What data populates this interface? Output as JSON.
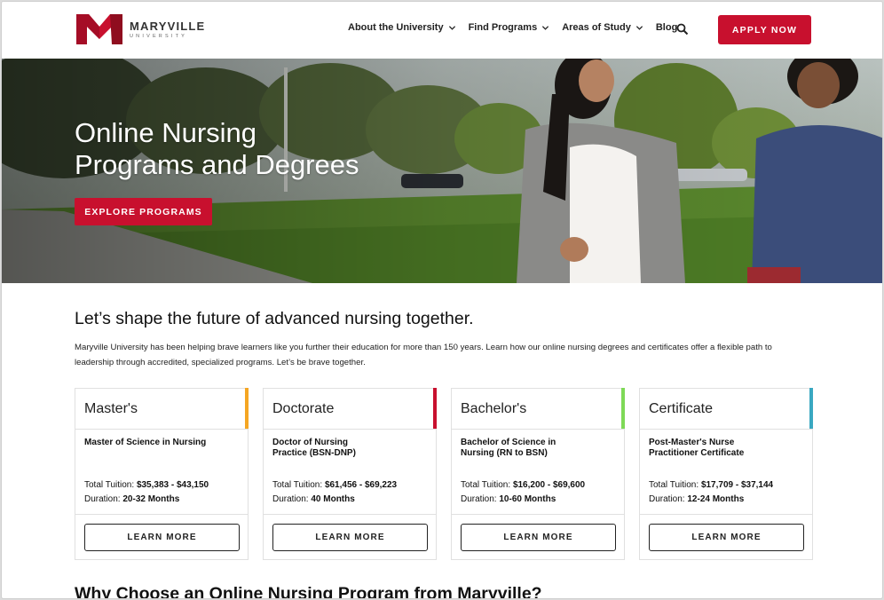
{
  "brand": {
    "name": "MARYVILLE",
    "sub": "UNIVERSITY",
    "colors": {
      "primary": "#c8102e",
      "dark_red": "#8f0d1f"
    }
  },
  "nav": {
    "items": [
      {
        "label": "About the University",
        "has_dropdown": true
      },
      {
        "label": "Find Programs",
        "has_dropdown": true
      },
      {
        "label": "Areas of Study",
        "has_dropdown": true
      },
      {
        "label": "Blog",
        "has_dropdown": false
      }
    ],
    "search_icon": "search-icon",
    "apply_label": "APPLY NOW"
  },
  "hero": {
    "title_line1": "Online Nursing",
    "title_line2": "Programs and Degrees",
    "cta_label": "EXPLORE PROGRAMS"
  },
  "intro": {
    "heading": "Let’s shape the future of advanced nursing together.",
    "body": "Maryville University has been helping brave learners like you further their education for more than 150 years. Learn how our online nursing degrees and certificates offer a flexible path to leadership through accredited, specialized programs. Let’s be brave together."
  },
  "cards": [
    {
      "title": "Master's",
      "program": "Master of Science in Nursing",
      "tuition_label": "Total Tuition:",
      "tuition": "$35,383 - $43,150",
      "duration_label": "Duration:",
      "duration": "20-32 Months",
      "button": "LEARN MORE",
      "accent": "#f5a623"
    },
    {
      "title": "Doctorate",
      "program": "Doctor of Nursing Practice (BSN-DNP)",
      "tuition_label": "Total Tuition:",
      "tuition": "$61,456 - $69,223",
      "duration_label": "Duration:",
      "duration": "40 Months",
      "button": "LEARN MORE",
      "accent": "#c8102e"
    },
    {
      "title": "Bachelor's",
      "program": "Bachelor of Science in Nursing (RN to BSN)",
      "tuition_label": "Total Tuition:",
      "tuition": "$16,200 - $69,600",
      "duration_label": "Duration:",
      "duration": "10-60 Months",
      "button": "LEARN MORE",
      "accent": "#7ed957"
    },
    {
      "title": "Certificate",
      "program": "Post-Master's Nurse Practitioner Certificate",
      "tuition_label": "Total Tuition:",
      "tuition": "$17,709 - $37,144",
      "duration_label": "Duration:",
      "duration": "12-24 Months",
      "button": "LEARN MORE",
      "accent": "#3aa8c1"
    }
  ],
  "next_section": {
    "heading": "Why Choose an Online Nursing Program from Maryville?"
  }
}
